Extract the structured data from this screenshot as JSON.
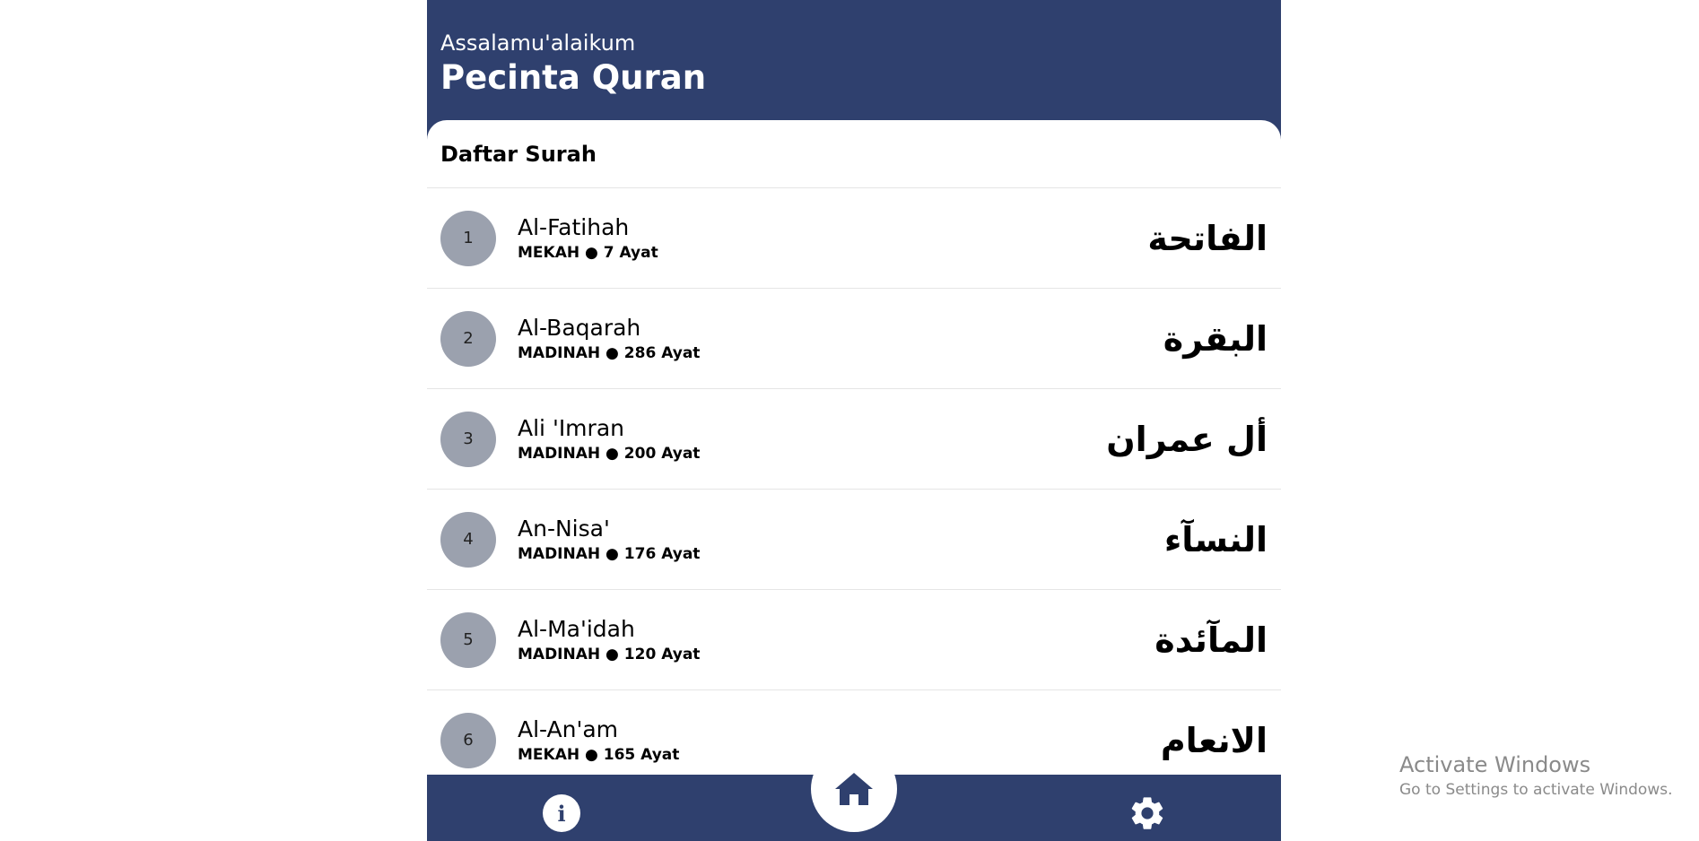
{
  "header": {
    "greeting": "Assalamu'alaikum",
    "username": "Pecinta Quran",
    "background_color": "#2f406e"
  },
  "section": {
    "title": "Daftar Surah"
  },
  "surahs": [
    {
      "number": "1",
      "name": "Al-Fatihah",
      "meta": "MEKAH ● 7 Ayat",
      "arabic": "الفاتحة"
    },
    {
      "number": "2",
      "name": "Al-Baqarah",
      "meta": "MADINAH ● 286 Ayat",
      "arabic": "البقرة"
    },
    {
      "number": "3",
      "name": "Ali 'Imran",
      "meta": "MADINAH ● 200 Ayat",
      "arabic": "أل عمران"
    },
    {
      "number": "4",
      "name": "An-Nisa'",
      "meta": "MADINAH ● 176 Ayat",
      "arabic": "النسآء"
    },
    {
      "number": "5",
      "name": "Al-Ma'idah",
      "meta": "MADINAH ● 120 Ayat",
      "arabic": "المآئدة"
    },
    {
      "number": "6",
      "name": "Al-An'am",
      "meta": "MEKAH ● 165 Ayat",
      "arabic": "الانعام"
    }
  ],
  "nav": {
    "info_icon": "info-icon",
    "home_icon": "home-icon",
    "settings_icon": "gear-icon",
    "badge_color": "#9ba1ae"
  },
  "watermark": {
    "title": "Activate Windows",
    "subtitle": "Go to Settings to activate Windows."
  }
}
